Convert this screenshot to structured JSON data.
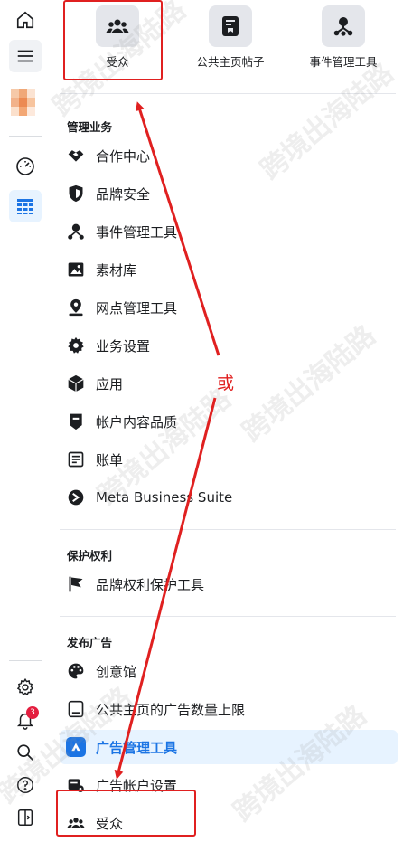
{
  "top_tools": [
    {
      "label": "受众"
    },
    {
      "label": "公共主页帖子"
    },
    {
      "label": "事件管理工具"
    }
  ],
  "sections": {
    "manage_business": {
      "title": "管理业务",
      "items": [
        {
          "label": "合作中心"
        },
        {
          "label": "品牌安全"
        },
        {
          "label": "事件管理工具"
        },
        {
          "label": "素材库"
        },
        {
          "label": "网点管理工具"
        },
        {
          "label": "业务设置"
        },
        {
          "label": "应用"
        },
        {
          "label": "帐户内容品质"
        },
        {
          "label": "账单"
        },
        {
          "label": "Meta Business Suite"
        }
      ]
    },
    "protect_rights": {
      "title": "保护权利",
      "items": [
        {
          "label": "品牌权利保护工具"
        }
      ]
    },
    "advertise": {
      "title": "发布广告",
      "items": [
        {
          "label": "创意馆"
        },
        {
          "label": "公共主页的广告数量上限"
        },
        {
          "label": "广告管理工具"
        },
        {
          "label": "广告帐户设置"
        },
        {
          "label": "受众"
        }
      ]
    }
  },
  "rail": {
    "notification_count": "3"
  },
  "annotation": {
    "or_text": "或",
    "color": "#e02020"
  },
  "watermark": {
    "text": "跨境出海陆路"
  },
  "colors": {
    "accent": "#1b74e4",
    "active_bg": "#e7f3ff",
    "badge": "#e41e3f"
  }
}
